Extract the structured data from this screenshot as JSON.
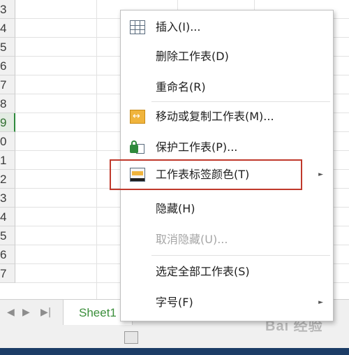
{
  "sheet": {
    "row_numbers": [
      "3",
      "4",
      "5",
      "6",
      "7",
      "8",
      "9",
      "0",
      "1",
      "2",
      "3",
      "4",
      "5",
      "6",
      "7"
    ],
    "active_row": "9",
    "tab_name": "Sheet1",
    "nav_first": "◀",
    "nav_prev": "▶",
    "nav_next": "▶|",
    "watermark": "Bai 经验"
  },
  "context_menu": {
    "items": [
      {
        "label": "插入(I)...",
        "icon": "table-icon",
        "enabled": true
      },
      {
        "label": "删除工作表(D)",
        "icon": "",
        "enabled": true
      },
      {
        "label": "重命名(R)",
        "icon": "",
        "enabled": true
      },
      {
        "label": "移动或复制工作表(M)...",
        "icon": "move-copy-icon",
        "enabled": true
      },
      {
        "label": "保护工作表(P)...",
        "icon": "lock-icon",
        "enabled": true
      },
      {
        "label": "工作表标签颜色(T)",
        "icon": "tab-color-icon",
        "enabled": true,
        "submenu": true,
        "highlighted": true
      },
      {
        "label": "隐藏(H)",
        "icon": "",
        "enabled": true
      },
      {
        "label": "取消隐藏(U)...",
        "icon": "",
        "enabled": false
      },
      {
        "label": "选定全部工作表(S)",
        "icon": "",
        "enabled": true
      },
      {
        "label": "字号(F)",
        "icon": "",
        "enabled": true,
        "submenu": true
      }
    ],
    "submenu_arrow": "►"
  },
  "colors": {
    "highlight_border": "#c0392b",
    "active_tab_text": "#3b8e3b",
    "disabled_text": "#a6a6a6"
  }
}
